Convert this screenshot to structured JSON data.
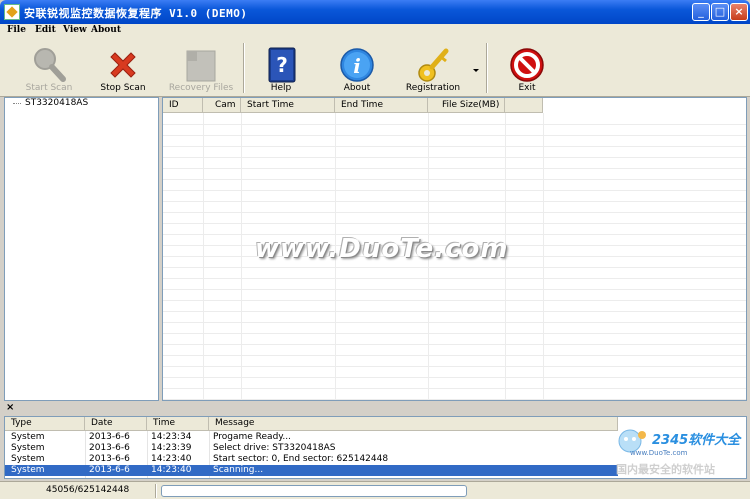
{
  "window": {
    "title": "安联锐视监控数据恢复程序 V1.0 (DEMO)",
    "min_glyph": "_",
    "max_glyph": "□",
    "close_glyph": "×"
  },
  "menu": {
    "file": "File",
    "edit": "Edit",
    "view": "View",
    "about": "About"
  },
  "toolbar": {
    "start_scan": "Start Scan",
    "stop_scan": "Stop Scan",
    "recovery_files": "Recovery  Files",
    "help": "Help",
    "about": "About",
    "registration": "Registration",
    "exit": "Exit"
  },
  "tree": {
    "drive": "ST3320418AS"
  },
  "grid": {
    "columns": [
      "ID",
      "Cam",
      "Start Time",
      "End Time",
      "File Size(MB)",
      ""
    ]
  },
  "watermark": "www.DuoTe.com",
  "log": {
    "close_glyph": "×",
    "columns": [
      "Type",
      "Date",
      "Time",
      "Message"
    ],
    "rows": [
      {
        "type": "System",
        "date": "2013-6-6",
        "time": "14:23:34",
        "message": "Progame Ready..."
      },
      {
        "type": "System",
        "date": "2013-6-6",
        "time": "14:23:39",
        "message": "Select drive: ST3320418AS"
      },
      {
        "type": "System",
        "date": "2013-6-6",
        "time": "14:23:40",
        "message": "Start sector: 0, End sector: 625142448"
      },
      {
        "type": "System",
        "date": "2013-6-6",
        "time": "14:23:40",
        "message": "Scanning..."
      }
    ]
  },
  "status": {
    "sector_progress": "45056/625142448",
    "progress_fraction": 0.0
  },
  "corner": {
    "brand": "2345软件大全",
    "site": "www.DuoTe.com",
    "slogan": "国内最安全的软件站"
  },
  "colors": {
    "titlebar": "#0a57d9",
    "selection": "#316ac5",
    "stop_red": "#d83a20",
    "exit_red": "#d01010"
  }
}
